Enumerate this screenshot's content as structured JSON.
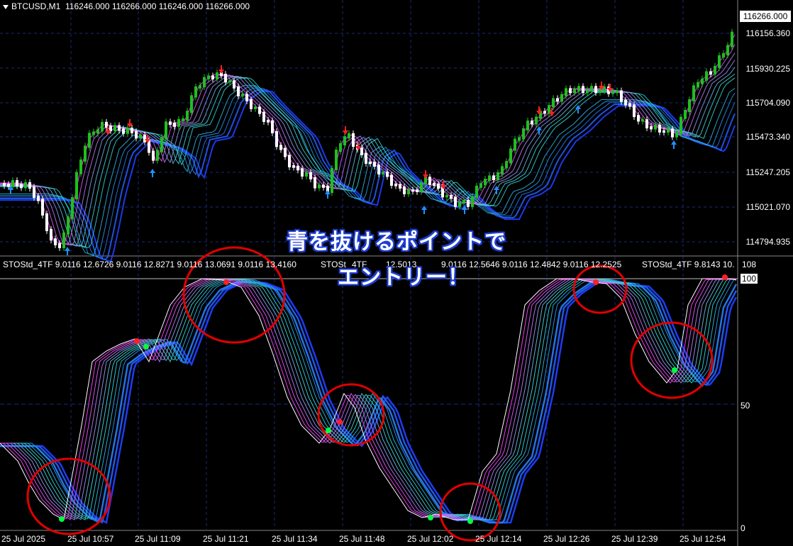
{
  "header": {
    "symbol": "BTCUSD,M1",
    "ohlc": "116246.000 116266.000 116246.000 116266.000"
  },
  "price_axis": {
    "current": "116266.000",
    "labels": [
      "116156.360",
      "115930.225",
      "115704.090",
      "115473.340",
      "115247.205",
      "115021.070",
      "114794.935"
    ]
  },
  "indicator": {
    "tag1": "STOStd_4TF 9.0116 12.6726 9.0116 12.8271 9.0116 13.0691 9.0116 13.4160",
    "tag2": "STOSt",
    "tag2b": "4TF",
    "tag2c": "12.5013",
    "tag3": "9.0116 12.5646 9.0116 12.4842 9.0116 12.2525",
    "tag4": "STOStd_4TF 9.8143 10.",
    "scale_top": "108",
    "level_100": "100",
    "level_50": "50",
    "level_0": "0"
  },
  "time_axis": [
    "25 Jul 2025",
    "25 Jul 10:57",
    "25 Jul 11:09",
    "25 Jul 11:21",
    "25 Jul 11:34",
    "25 Jul 11:48",
    "25 Jul 12:02",
    "25 Jul 12:14",
    "25 Jul 12:26",
    "25 Jul 12:39",
    "25 Jul 12:54"
  ],
  "annotation": {
    "line1": "青を抜けるポイントで",
    "line2": "エントリー！"
  },
  "colors": {
    "background": "#000000",
    "grid": "#1a2a7a",
    "bull": "#1fbf1f",
    "bear": "#ffffff",
    "ribbon_fast": "#ff3cff",
    "ribbon_mid": "#30e0d0",
    "ribbon_slow": "#1f3fff",
    "circle": "#e00000",
    "dot_up": "#00ff40",
    "dot_down": "#ff2020",
    "arrow_up": "#1e90ff",
    "arrow_down": "#ff2020"
  }
}
